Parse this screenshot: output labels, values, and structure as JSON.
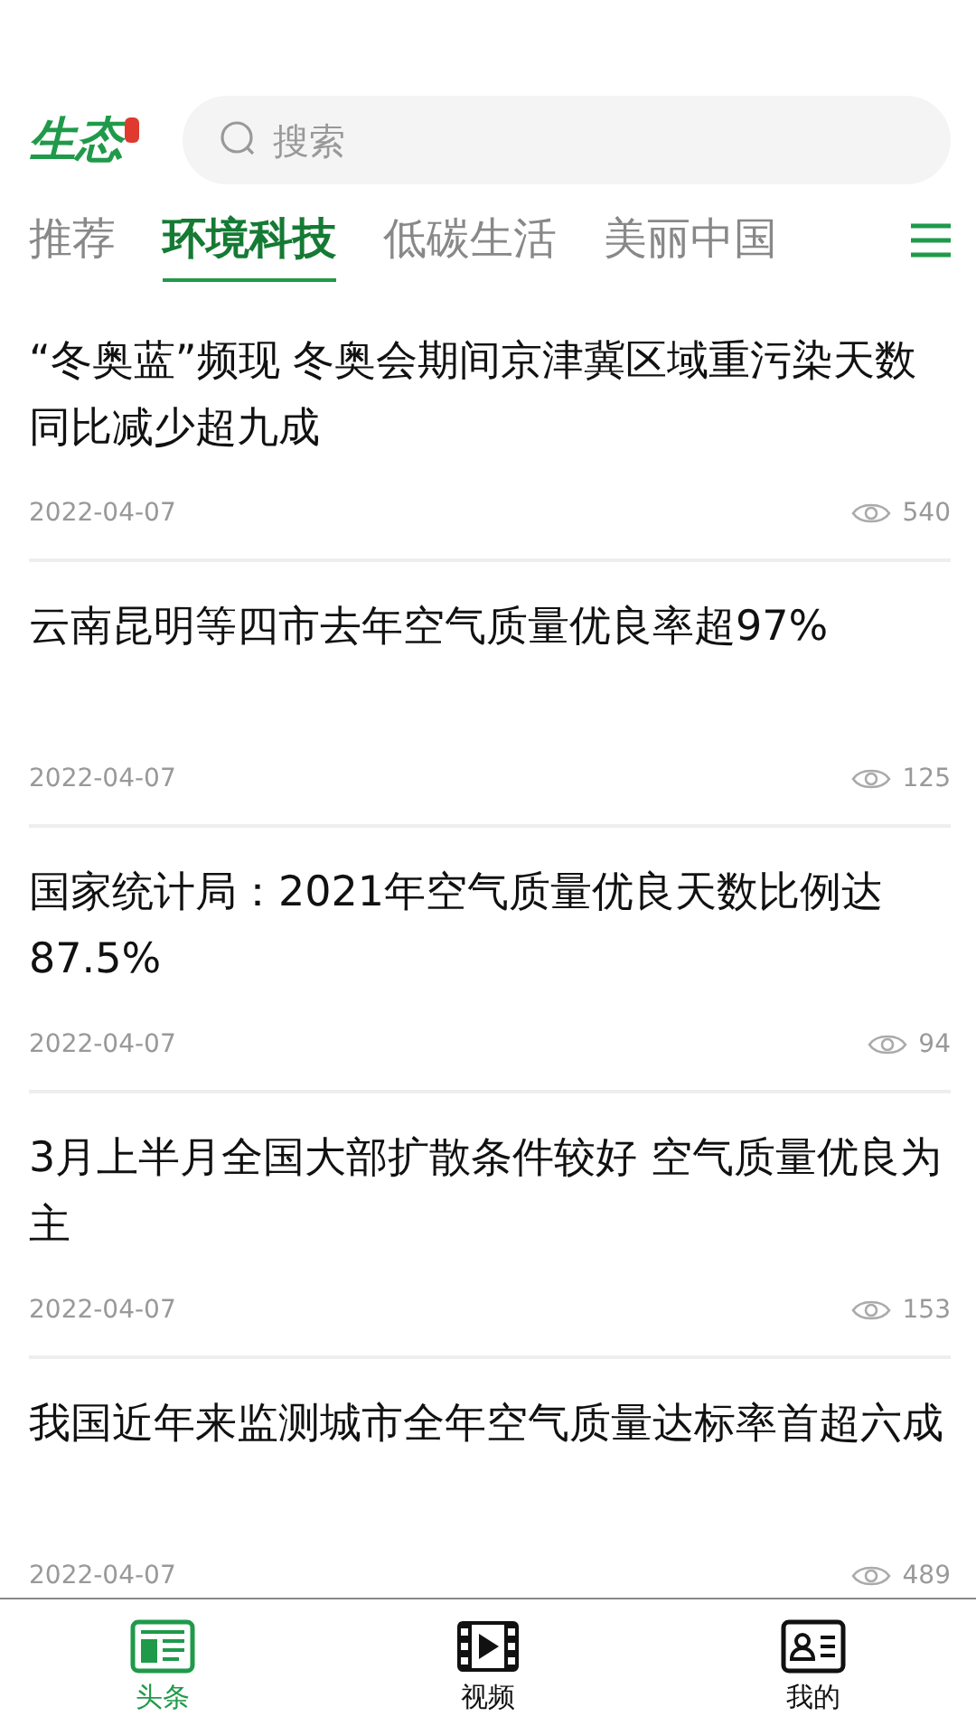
{
  "logo": {
    "text": "生态"
  },
  "search": {
    "placeholder": "搜索"
  },
  "tabs": [
    {
      "label": "推荐",
      "selected": false
    },
    {
      "label": "环境科技",
      "selected": true
    },
    {
      "label": "低碳生活",
      "selected": false
    },
    {
      "label": "美丽中国",
      "selected": false
    }
  ],
  "articles": [
    {
      "title": "“冬奥蓝”频现 冬奥会期间京津冀区域重污染天数同比减少超九成",
      "date": "2022-04-07",
      "views": "540"
    },
    {
      "title": "云南昆明等四市去年空气质量优良率超97%",
      "date": "2022-04-07",
      "views": "125"
    },
    {
      "title": "国家统计局：2021年空气质量优良天数比例达87.5%",
      "date": "2022-04-07",
      "views": "94"
    },
    {
      "title": "3月上半月全国大部扩散条件较好 空气质量优良为主",
      "date": "2022-04-07",
      "views": "153"
    },
    {
      "title": "我国近年来监测城市全年空气质量达标率首超六成",
      "date": "2022-04-07",
      "views": "489"
    }
  ],
  "bottom_nav": [
    {
      "label": "头条",
      "kind": "news",
      "selected": true
    },
    {
      "label": "视频",
      "kind": "video",
      "selected": false
    },
    {
      "label": "我的",
      "kind": "profile",
      "selected": false
    }
  ]
}
